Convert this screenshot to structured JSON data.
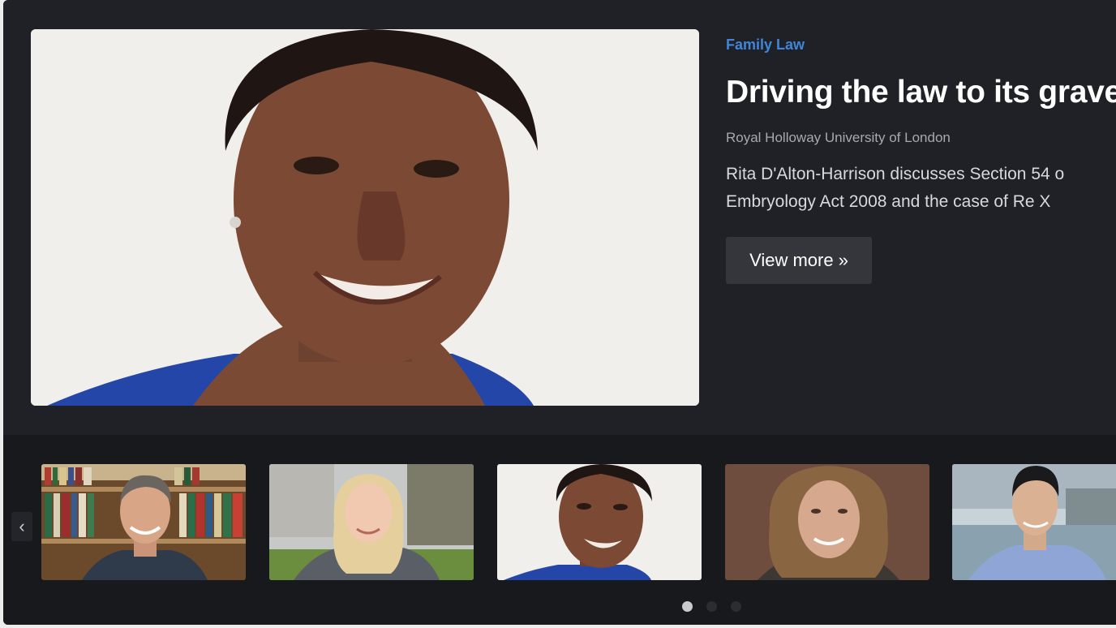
{
  "featured": {
    "category": "Family Law",
    "title": "Driving the law to its grave",
    "institution": "Royal Holloway University of London",
    "description_lines": [
      "Rita D'Alton-Harrison discusses Section 54 o",
      "Embryology Act 2008 and  the case of Re X"
    ],
    "view_more_label": "View more »"
  },
  "carousel": {
    "prev_icon": "chevron-left-icon",
    "prev_glyph": "‹",
    "thumbnails": [
      {
        "name": "thumbnail-1",
        "active": false
      },
      {
        "name": "thumbnail-2",
        "active": false
      },
      {
        "name": "thumbnail-3",
        "active": true
      },
      {
        "name": "thumbnail-4",
        "active": false
      },
      {
        "name": "thumbnail-5",
        "active": false
      }
    ],
    "pages": 3,
    "current_page": 1
  },
  "colors": {
    "background": "#1c1e24",
    "strip": "#17191d",
    "category": "#3f86d9",
    "button": "#34363b"
  }
}
